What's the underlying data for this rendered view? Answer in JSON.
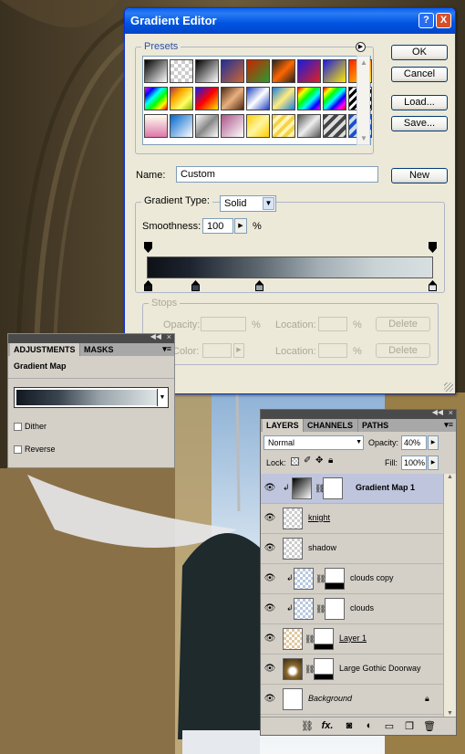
{
  "gradient_editor": {
    "title": "Gradient Editor",
    "help": "?",
    "close": "X",
    "presets_label": "Presets",
    "ok": "OK",
    "cancel": "Cancel",
    "load": "Load...",
    "save": "Save...",
    "name_label": "Name:",
    "name_value": "Custom",
    "new": "New",
    "gradient_type_label": "Gradient Type:",
    "gradient_type_value": "Solid",
    "smoothness_label": "Smoothness:",
    "smoothness_value": "100",
    "percent": "%",
    "stops_label": "Stops",
    "opacity_label": "Opacity:",
    "color_label": "Color:",
    "location_label": "Location:",
    "delete": "Delete"
  },
  "adjustments": {
    "tab_adjustments": "ADJUSTMENTS",
    "tab_masks": "MASKS",
    "heading": "Gradient Map",
    "dither": "Dither",
    "reverse": "Reverse"
  },
  "layers": {
    "tab_layers": "LAYERS",
    "tab_channels": "CHANNELS",
    "tab_paths": "PATHS",
    "blend_mode": "Normal",
    "opacity_label": "Opacity:",
    "opacity_value": "40%",
    "lock_label": "Lock:",
    "fill_label": "Fill:",
    "fill_value": "100%",
    "items": [
      {
        "name": "Gradient Map 1"
      },
      {
        "name": "knight"
      },
      {
        "name": "shadow"
      },
      {
        "name": "clouds copy"
      },
      {
        "name": "clouds"
      },
      {
        "name": "Layer 1"
      },
      {
        "name": "Large Gothic Doorway"
      },
      {
        "name": "Background"
      }
    ]
  }
}
